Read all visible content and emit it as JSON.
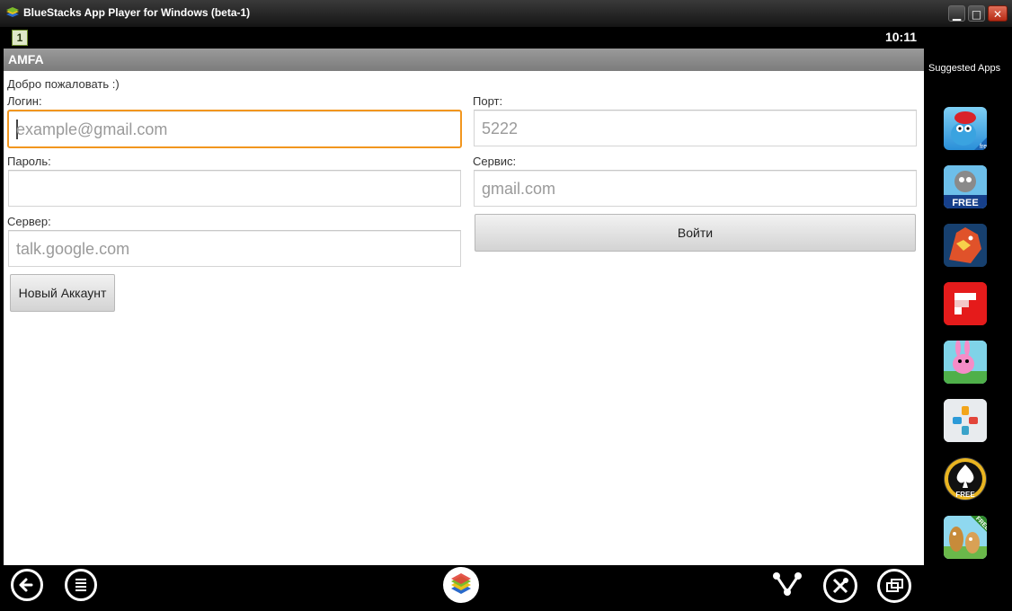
{
  "window": {
    "title": "BlueStacks App Player for Windows (beta-1)",
    "minimize_glyph": "▁",
    "maximize_glyph": "□",
    "close_glyph": "✕"
  },
  "status_bar": {
    "notification_badge": "1",
    "clock": "10:11"
  },
  "app_bar": {
    "title": "AMFA"
  },
  "form": {
    "welcome": "Добро пожаловать :)",
    "login_label": "Логин:",
    "login_placeholder": "example@gmail.com",
    "port_label": "Порт:",
    "port_placeholder": "5222",
    "password_label": "Пароль:",
    "password_value": "",
    "service_label": "Сервис:",
    "service_placeholder": "gmail.com",
    "server_label": "Сервер:",
    "server_placeholder": "talk.google.com",
    "login_button": "Войти",
    "new_account_button": "Новый Аккаунт"
  },
  "sidebar": {
    "title": "Suggested Apps",
    "apps": [
      {
        "icon": "blue-creature-app-icon",
        "badge": "free"
      },
      {
        "icon": "sheep-game-app-icon",
        "badge": "FREE"
      },
      {
        "icon": "dragon-game-app-icon",
        "badge": ""
      },
      {
        "icon": "flipboard-app-icon",
        "badge": ""
      },
      {
        "icon": "pink-bunny-app-icon",
        "badge": ""
      },
      {
        "icon": "tango-app-icon",
        "badge": ""
      },
      {
        "icon": "spades-game-app-icon",
        "badge": "FREE"
      },
      {
        "icon": "giraffe-game-app-icon",
        "badge": "FREE"
      }
    ]
  },
  "nav": {
    "icons": [
      "back-icon",
      "menu-icon",
      "bluestacks-home-icon",
      "share-icon",
      "settings-icon",
      "window-mode-icon"
    ]
  },
  "colors": {
    "focus_orange": "#f2961e",
    "app_bar_gray": "#8a8a8a",
    "bluestacks_green": "#7dbb2a"
  }
}
